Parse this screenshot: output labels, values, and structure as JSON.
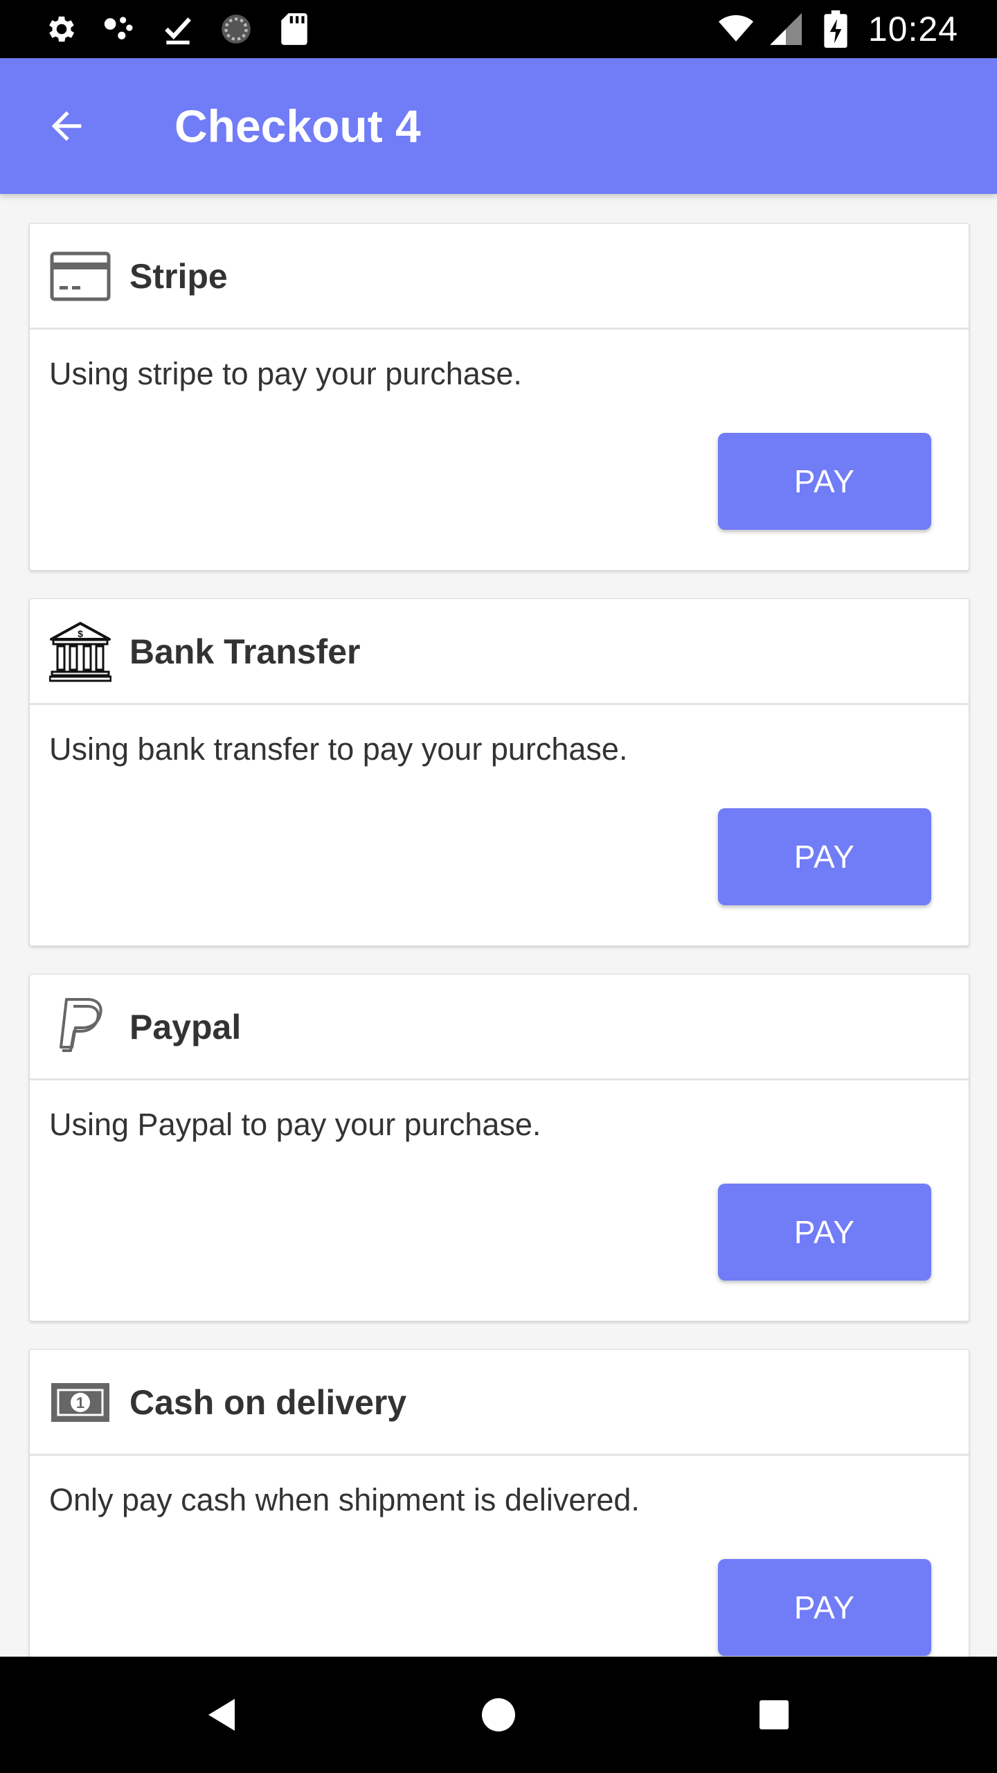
{
  "status_bar": {
    "time": "10:24",
    "left_icons": [
      "settings-icon",
      "assistant-icon",
      "download-done-icon",
      "sync-icon",
      "sd-card-icon"
    ],
    "right_icons": [
      "wifi-icon",
      "cellular-signal-icon",
      "battery-charging-icon"
    ]
  },
  "app_bar": {
    "title": "Checkout 4",
    "back_icon": "arrow-back-icon",
    "color": "#717cf7"
  },
  "payment_methods": [
    {
      "name": "Stripe",
      "icon": "credit-card-icon",
      "description": "Using stripe to pay your purchase.",
      "button_label": "PAY"
    },
    {
      "name": "Bank Transfer",
      "icon": "bank-icon",
      "description": "Using bank transfer to pay your purchase.",
      "button_label": "PAY"
    },
    {
      "name": "Paypal",
      "icon": "paypal-icon",
      "description": "Using Paypal to pay your purchase.",
      "button_label": "PAY"
    },
    {
      "name": "Cash on delivery",
      "icon": "cash-icon",
      "description": "Only pay cash when shipment is delivered.",
      "button_label": "PAY"
    }
  ],
  "nav_bar": {
    "buttons": [
      "back-triangle-icon",
      "home-circle-icon",
      "recents-square-icon"
    ]
  }
}
